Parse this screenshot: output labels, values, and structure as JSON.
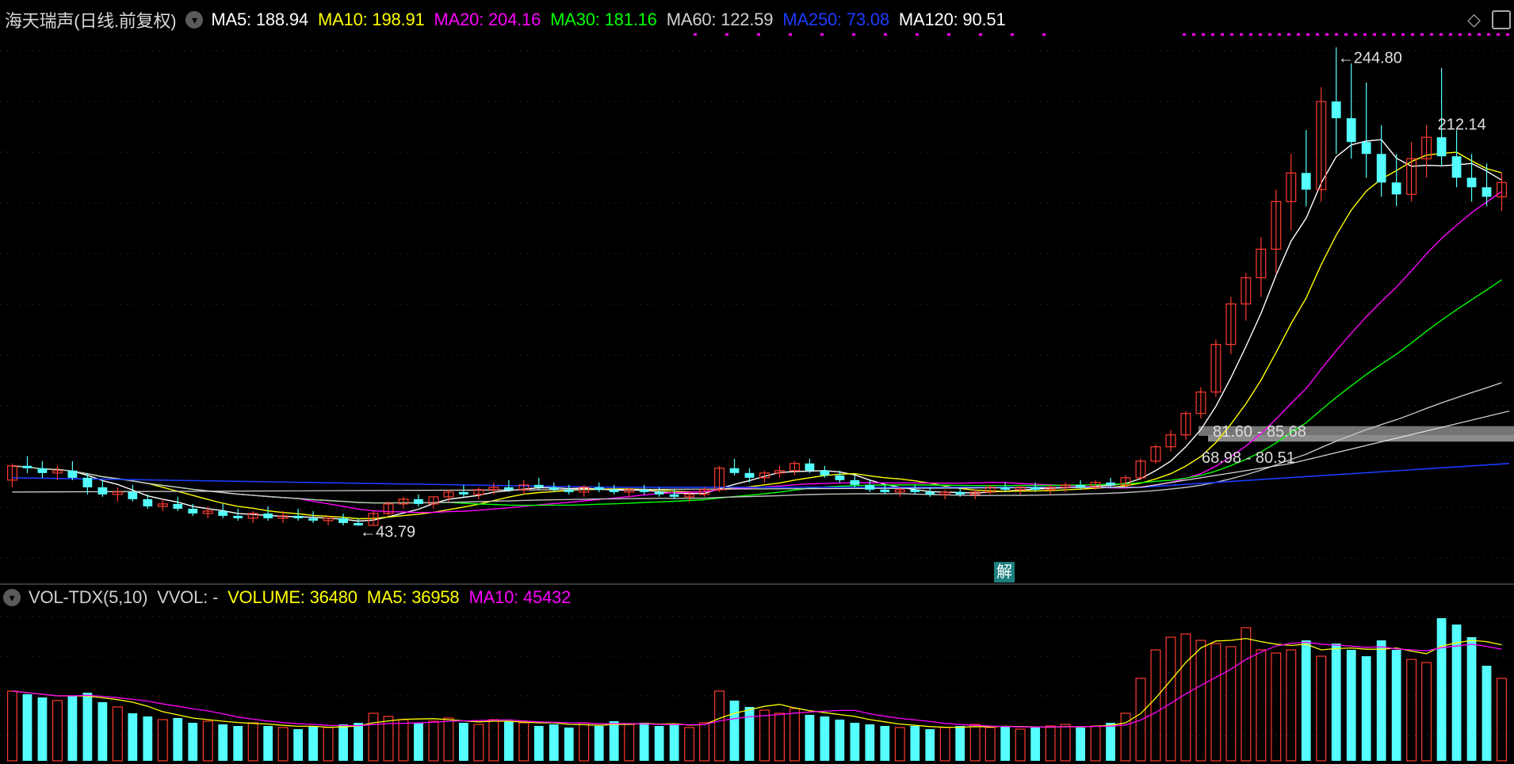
{
  "price_header": {
    "title": "海天瑞声(日线.前复权)",
    "ma_items": [
      {
        "label": "MA5: 188.94",
        "color": "#ffffff"
      },
      {
        "label": "MA10: 198.91",
        "color": "#ffff00"
      },
      {
        "label": "MA20: 204.16",
        "color": "#ff00ff"
      },
      {
        "label": "MA30: 181.16",
        "color": "#00ff00"
      },
      {
        "label": "MA60: 122.59",
        "color": "#d0d0d0"
      },
      {
        "label": "MA250: 73.08",
        "color": "#1c3cff"
      },
      {
        "label": "MA120: 90.51",
        "color": "#ffffff"
      }
    ]
  },
  "volume_header": {
    "title": "VOL-TDX(5,10)",
    "items": [
      {
        "label": "VVOL: -",
        "color": "#d0d0d0"
      },
      {
        "label": "VOLUME: 36480",
        "color": "#ffff00"
      },
      {
        "label": "MA5: 36958",
        "color": "#ffff00"
      },
      {
        "label": "MA10: 45432",
        "color": "#ff00ff"
      }
    ]
  },
  "icons": {
    "dropdown": "chevron-down-icon",
    "diamond": "diamond-icon",
    "window": "window-icon"
  },
  "unlock_badge": "解",
  "chart_data": {
    "type": "candlestick",
    "price_axis": {
      "ylim": [
        25,
        250
      ]
    },
    "annotations": {
      "high": "244.80",
      "high2": "212.14",
      "low": "43.79",
      "zone_upper": "81.60 - 85.68",
      "zone_lower": "68.98 - 80.51"
    },
    "colors": {
      "up": "#ff3b30",
      "down": "#55ffff"
    },
    "candles": [
      [
        63,
        70,
        60,
        69
      ],
      [
        69,
        73,
        66,
        68
      ],
      [
        68,
        71,
        64,
        66
      ],
      [
        66,
        69,
        63,
        67
      ],
      [
        67,
        71,
        63,
        64
      ],
      [
        64,
        66,
        57,
        60
      ],
      [
        60,
        63,
        56,
        57
      ],
      [
        57,
        60,
        54,
        58
      ],
      [
        58,
        61,
        54,
        55
      ],
      [
        55,
        57,
        51,
        52
      ],
      [
        52,
        55,
        50,
        53
      ],
      [
        53,
        56,
        50,
        51
      ],
      [
        51,
        53,
        48,
        49
      ],
      [
        49,
        52,
        47,
        50
      ],
      [
        50,
        53,
        47,
        48
      ],
      [
        48,
        51,
        46,
        47
      ],
      [
        47,
        50,
        45,
        49
      ],
      [
        49,
        52,
        46,
        47
      ],
      [
        47,
        50,
        45,
        48
      ],
      [
        48,
        51,
        46,
        47
      ],
      [
        47,
        50,
        45,
        46
      ],
      [
        46,
        48,
        44,
        47
      ],
      [
        47,
        49,
        44,
        45
      ],
      [
        45,
        47,
        43.79,
        44
      ],
      [
        44,
        50,
        44,
        49
      ],
      [
        49,
        54,
        48,
        53
      ],
      [
        53,
        56,
        51,
        55
      ],
      [
        55,
        57,
        52,
        53
      ],
      [
        53,
        56,
        51,
        56
      ],
      [
        56,
        59,
        54,
        58
      ],
      [
        58,
        61,
        56,
        57
      ],
      [
        57,
        60,
        55,
        59
      ],
      [
        59,
        62,
        57,
        60
      ],
      [
        60,
        63,
        58,
        59
      ],
      [
        59,
        63,
        57,
        61
      ],
      [
        61,
        64,
        59,
        60
      ],
      [
        60,
        62,
        58,
        59
      ],
      [
        59,
        61,
        57,
        58
      ],
      [
        58,
        61,
        56,
        60
      ],
      [
        60,
        62,
        58,
        59
      ],
      [
        59,
        61,
        57,
        58
      ],
      [
        58,
        60,
        56,
        59
      ],
      [
        59,
        61,
        57,
        58
      ],
      [
        58,
        60,
        56,
        57
      ],
      [
        57,
        59,
        55,
        56
      ],
      [
        56,
        58,
        54,
        57
      ],
      [
        57,
        60,
        56,
        59
      ],
      [
        59,
        69,
        58,
        68
      ],
      [
        68,
        72,
        65,
        66
      ],
      [
        66,
        68,
        62,
        64
      ],
      [
        64,
        67,
        62,
        66
      ],
      [
        66,
        69,
        64,
        67
      ],
      [
        67,
        71,
        65,
        70
      ],
      [
        70,
        72,
        66,
        67
      ],
      [
        67,
        69,
        64,
        65
      ],
      [
        65,
        67,
        62,
        63
      ],
      [
        63,
        65,
        60,
        61
      ],
      [
        61,
        63,
        58,
        59
      ],
      [
        59,
        61,
        57,
        58
      ],
      [
        58,
        60,
        56,
        59
      ],
      [
        59,
        61,
        57,
        58
      ],
      [
        58,
        60,
        56,
        57
      ],
      [
        57,
        59,
        55,
        58
      ],
      [
        58,
        60,
        56,
        57
      ],
      [
        57,
        59,
        55,
        58
      ],
      [
        58,
        61,
        57,
        60
      ],
      [
        60,
        62,
        58,
        59
      ],
      [
        59,
        61,
        57,
        60
      ],
      [
        60,
        62,
        58,
        59
      ],
      [
        59,
        61,
        57,
        60
      ],
      [
        60,
        62,
        58,
        61
      ],
      [
        61,
        63,
        59,
        60
      ],
      [
        60,
        63,
        59,
        62
      ],
      [
        62,
        64,
        60,
        61
      ],
      [
        61,
        65,
        60,
        64
      ],
      [
        64,
        72,
        63,
        71
      ],
      [
        71,
        78,
        70,
        77
      ],
      [
        77,
        84,
        75,
        82
      ],
      [
        82,
        92,
        80,
        91
      ],
      [
        91,
        102,
        89,
        100
      ],
      [
        100,
        122,
        98,
        120
      ],
      [
        120,
        140,
        116,
        137
      ],
      [
        137,
        150,
        130,
        148
      ],
      [
        148,
        165,
        140,
        160
      ],
      [
        160,
        185,
        150,
        180
      ],
      [
        180,
        200,
        168,
        192
      ],
      [
        192,
        210,
        178,
        185
      ],
      [
        185,
        228,
        180,
        222
      ],
      [
        222,
        244.8,
        200,
        215
      ],
      [
        215,
        238,
        198,
        205
      ],
      [
        205,
        230,
        190,
        200
      ],
      [
        200,
        212,
        182,
        188
      ],
      [
        188,
        200,
        178,
        183
      ],
      [
        183,
        205,
        180,
        198
      ],
      [
        198,
        212.14,
        190,
        207
      ],
      [
        207,
        236,
        195,
        199
      ],
      [
        199,
        210,
        186,
        190
      ],
      [
        190,
        200,
        180,
        186
      ],
      [
        186,
        196,
        178,
        182
      ],
      [
        182,
        192,
        176,
        188
      ]
    ],
    "volume": [
      44,
      42,
      40,
      38,
      41,
      43,
      37,
      34,
      30,
      28,
      26,
      27,
      24,
      25,
      23,
      22,
      24,
      22,
      21,
      20,
      22,
      21,
      23,
      24,
      30,
      28,
      26,
      24,
      25,
      27,
      24,
      23,
      26,
      25,
      24,
      22,
      23,
      21,
      24,
      22,
      25,
      23,
      24,
      22,
      23,
      21,
      24,
      44,
      38,
      34,
      32,
      30,
      33,
      29,
      28,
      26,
      24,
      23,
      22,
      21,
      22,
      20,
      21,
      22,
      23,
      21,
      22,
      20,
      21,
      22,
      23,
      21,
      22,
      24,
      30,
      52,
      70,
      78,
      80,
      76,
      74,
      72,
      84,
      70,
      68,
      70,
      76,
      66,
      74,
      70,
      66,
      76,
      70,
      64,
      62,
      90,
      86,
      78,
      60,
      52
    ],
    "volume_colors_up": true
  }
}
